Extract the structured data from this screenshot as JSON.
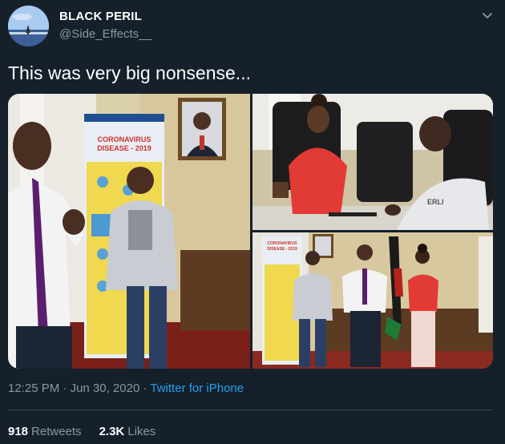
{
  "author": {
    "display_name": "BLACK PERIL",
    "handle": "@Side_Effects__",
    "avatar_icon": "avatar-photo"
  },
  "tweet": {
    "text": "This was very big nonsense..."
  },
  "media": {
    "photo_count": 3,
    "poster_text": "CORONAVIRUS DISEASE - 2019"
  },
  "meta": {
    "time": "12:25 PM",
    "separator": "·",
    "date": "Jun 30, 2020",
    "source": "Twitter for iPhone"
  },
  "stats": {
    "retweets_count": "918",
    "retweets_label": "Retweets",
    "likes_count": "2.3K",
    "likes_label": "Likes"
  },
  "colors": {
    "background": "#15202b",
    "secondary_text": "#8899a6",
    "link": "#1da1f2",
    "divider": "#38444d"
  }
}
